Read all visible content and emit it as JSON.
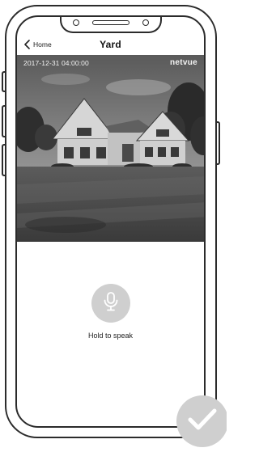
{
  "nav": {
    "back_label": "Home",
    "title": "Yard"
  },
  "video": {
    "timestamp": "2017-12-31 04:00:00",
    "brand": "netvue"
  },
  "talk": {
    "hold_label": "Hold to speak"
  },
  "icons": {
    "back": "chevron-left-icon",
    "mic": "microphone-icon",
    "check": "checkmark-icon"
  },
  "colors": {
    "mic_button": "#cfcfcf",
    "check_badge": "#cfcfcf",
    "outline": "#2b2b2b"
  }
}
